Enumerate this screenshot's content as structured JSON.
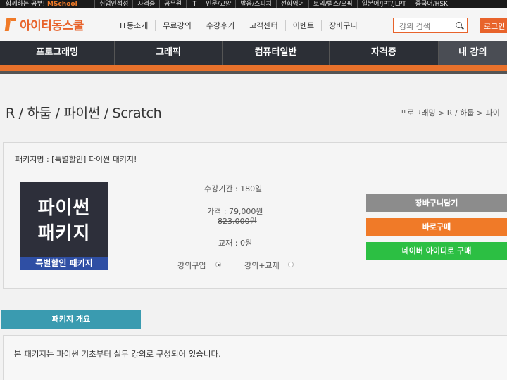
{
  "topstrip": {
    "promo_prefix": "함께하는 공부!",
    "promo_brand": "MSchool",
    "categories": [
      "취업인적성",
      "자격증",
      "공무원",
      "IT",
      "인문/교양",
      "발음/스피치",
      "전화영어",
      "토익/텝스/오픽",
      "일본어/JPT/JLPT",
      "중국어/HSK"
    ]
  },
  "header": {
    "logo_text": "아이티동스쿨",
    "nav": [
      "IT동소개",
      "무료강의",
      "수강후기",
      "고객센터",
      "이벤트",
      "장바구니"
    ],
    "search_placeholder": "강의 검색",
    "login_label": "로그인"
  },
  "category_bar": [
    "프로그래밍",
    "그래픽",
    "컴퓨터일반",
    "자격증",
    "내 강의"
  ],
  "page": {
    "title": "R / 하둡 / 파이썬 / Scratch",
    "breadcrumb": "프로그래밍 > R / 하둡 > 파이"
  },
  "package": {
    "name_line": "패키지명 : [특별할인] 파이썬 패키지!",
    "thumb_line1": "파이썬",
    "thumb_line2": "패키지",
    "thumb_band": "특별할인 패키지",
    "period": "수강기간 : 180일",
    "price": "가격 : 79,000원",
    "original_price": "823,000원",
    "material": "교재 : 0원",
    "option_lecture": "강의구입",
    "option_lecture_material": "강의+교재",
    "selected_option": "강의구입"
  },
  "buttons": {
    "cart": "장바구니담기",
    "buy_now": "바로구매",
    "naver": "네이버 아이디로 구매"
  },
  "overview": {
    "tab_label": "패키지 개요",
    "text": "본 패키지는 파이썬 기초부터 실무 강의로 구성되어 있습니다."
  },
  "colors": {
    "accent": "#e8632b",
    "nav_dark": "#2c2f36",
    "naver_green": "#2cbf43",
    "tab_teal": "#3a9bb0"
  }
}
